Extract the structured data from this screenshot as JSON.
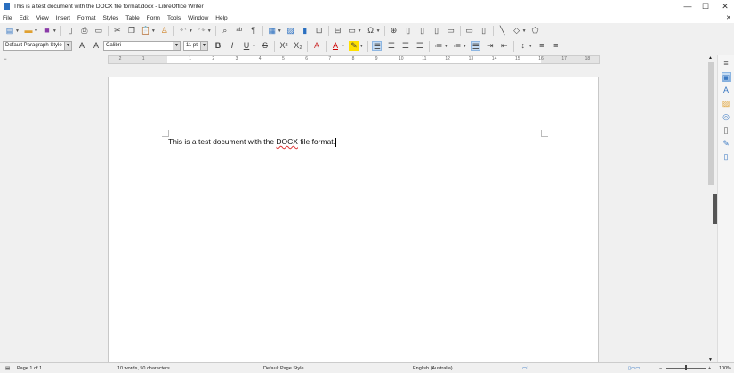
{
  "window": {
    "title": "This is a test document with the DOCX file format.docx - LibreOffice Writer",
    "minimize": "—",
    "maximize": "☐",
    "close": "✕",
    "doc_close": "✕"
  },
  "menu": [
    "File",
    "Edit",
    "View",
    "Insert",
    "Format",
    "Styles",
    "Table",
    "Form",
    "Tools",
    "Window",
    "Help"
  ],
  "toolbar2": {
    "paragraph_style": "Default Paragraph Style",
    "font_name": "Calibri",
    "font_size": "11 pt"
  },
  "ruler": {
    "numbers": [
      "2",
      "1",
      "1",
      "2",
      "3",
      "4",
      "5",
      "6",
      "7",
      "8",
      "9",
      "10",
      "11",
      "12",
      "13",
      "14",
      "15",
      "16",
      "17",
      "18"
    ]
  },
  "document": {
    "text_before": "This is a test document with the ",
    "text_misspelled": "DOCX",
    "text_after": " file format."
  },
  "status": {
    "page": "Page 1 of 1",
    "words": "10 words, 50 characters",
    "page_style": "Default Page Style",
    "language": "English (Australia)",
    "zoom": "100%"
  }
}
